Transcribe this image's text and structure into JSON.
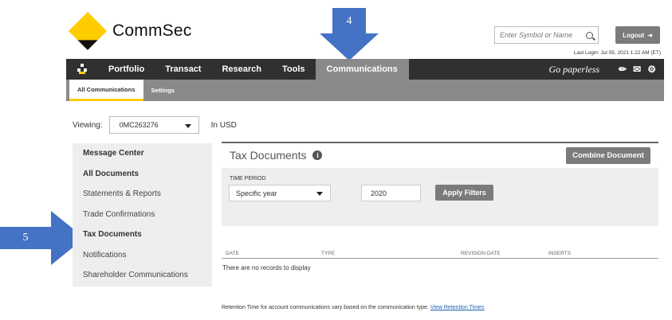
{
  "brand": {
    "name": "CommSec",
    "colors": {
      "yellow": "#ffcc00",
      "nav": "#303030",
      "accent": "#4472c4"
    }
  },
  "callouts": {
    "step4": "4",
    "step5": "5"
  },
  "header": {
    "search_placeholder": "Enter Symbol or Name",
    "logout_label": "Logout",
    "last_login": "Last Login: Jul 05, 2021 1:22 AM (ET)"
  },
  "nav": {
    "items": [
      {
        "label": "Portfolio"
      },
      {
        "label": "Transact"
      },
      {
        "label": "Research"
      },
      {
        "label": "Tools"
      },
      {
        "label": "Communications",
        "active": true
      }
    ],
    "go_paperless": "Go paperless"
  },
  "subnav": {
    "items": [
      {
        "label": "All Communications",
        "active": true
      },
      {
        "label": "Settings"
      }
    ]
  },
  "viewing": {
    "label": "Viewing:",
    "account": "0MC263276",
    "currency": "In USD"
  },
  "sidebar": {
    "items": [
      {
        "label": "Message Center"
      },
      {
        "label": "All Documents"
      },
      {
        "label": "Statements & Reports"
      },
      {
        "label": "Trade Confirmations"
      },
      {
        "label": "Tax Documents"
      },
      {
        "label": "Notifications"
      },
      {
        "label": "Shareholder Communications"
      }
    ]
  },
  "main": {
    "title": "Tax Documents",
    "combine_label": "Combine Document",
    "filters": {
      "time_period_label": "TIME PERIOD",
      "period_value": "Specific year",
      "year_value": "2020",
      "apply_label": "Apply Filters"
    },
    "table": {
      "columns": [
        "DATE",
        "TYPE",
        "REVISION DATE",
        "INSERTS"
      ],
      "empty_message": "There are no records to display"
    },
    "retention_text": "Retention Time for account communications vary based on the communication type.",
    "retention_link": "View Retention Times"
  }
}
